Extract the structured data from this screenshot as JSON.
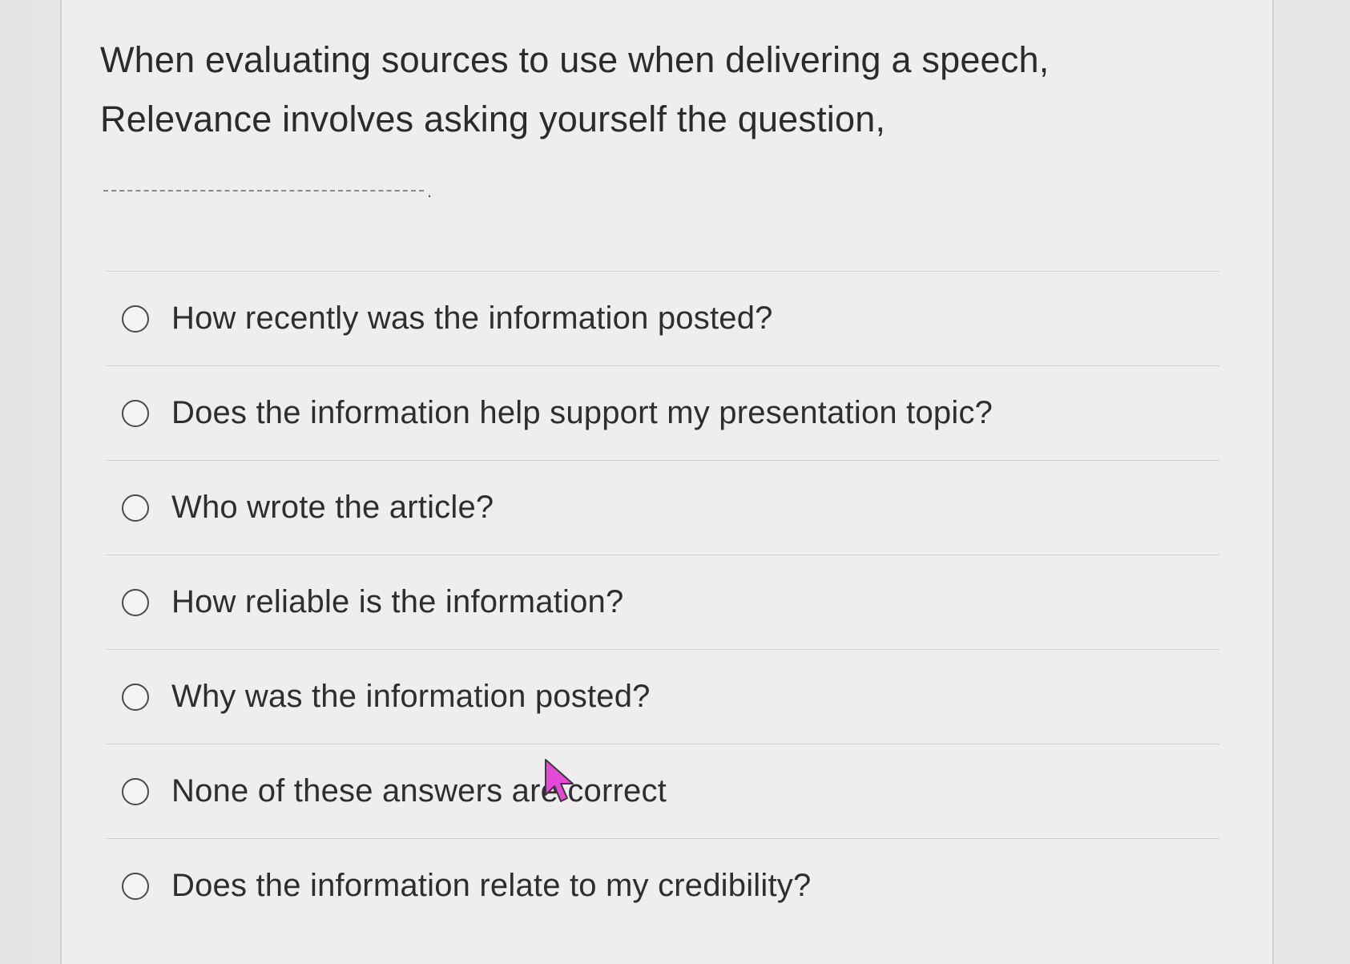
{
  "question": {
    "line1": "When evaluating sources to use when delivering a speech,",
    "line2": "Relevance involves asking yourself the question,",
    "blank_suffix": "."
  },
  "answers": [
    {
      "label": "How recently was the information posted?",
      "selected": false
    },
    {
      "label": "Does the information help support my presentation topic?",
      "selected": false
    },
    {
      "label": "Who wrote the article?",
      "selected": false
    },
    {
      "label": "How reliable is the information?",
      "selected": false
    },
    {
      "label": "Why was the information posted?",
      "selected": false
    },
    {
      "label": "None of these answers are correct",
      "selected": false
    },
    {
      "label": "Does the information relate to my credibility?",
      "selected": false
    }
  ],
  "icons": {
    "radio": "radio-unchecked-icon",
    "pointer": "mouse-pointer-icon"
  },
  "colors": {
    "cursor_fill": "#e24bd6",
    "text": "#2e2e2e"
  }
}
